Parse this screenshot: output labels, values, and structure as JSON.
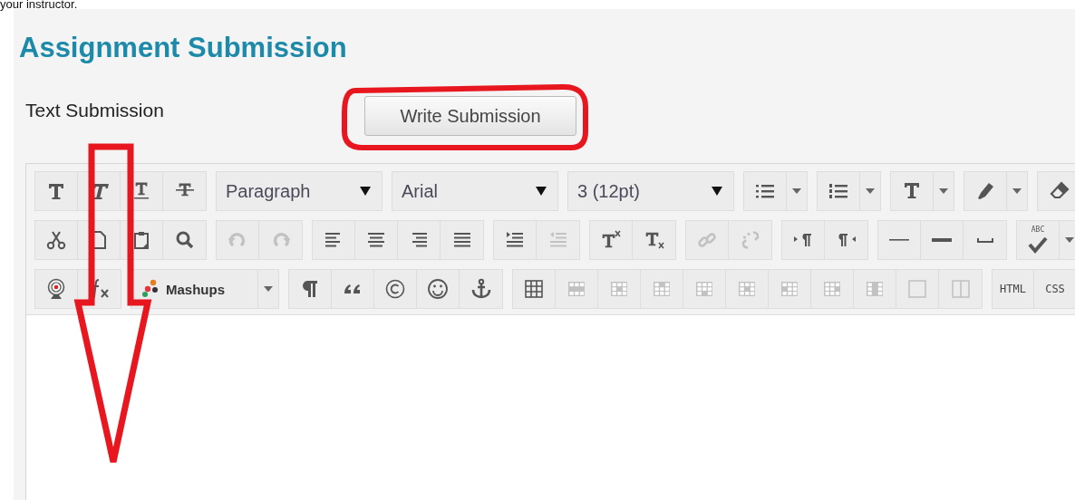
{
  "top_text": "your instructor.",
  "title": "Assignment Submission",
  "text_submission": {
    "label": "Text Submission",
    "button": "Write Submission"
  },
  "toolbar": {
    "rows": [
      {
        "groups": [
          {
            "items": [
              {
                "kind": "bold",
                "disabled": false
              },
              {
                "kind": "italic",
                "disabled": false
              },
              {
                "kind": "underline",
                "disabled": false
              },
              {
                "kind": "strike",
                "disabled": false
              }
            ]
          },
          {
            "items": [
              {
                "kind": "select",
                "value": "Paragraph",
                "disabled": false
              }
            ]
          },
          {
            "items": [
              {
                "kind": "select",
                "value": "Arial",
                "disabled": false
              }
            ]
          },
          {
            "items": [
              {
                "kind": "select",
                "value": "3 (12pt)",
                "disabled": false
              }
            ]
          },
          {
            "items": [
              {
                "kind": "bullets",
                "disabled": false
              }
            ]
          },
          {
            "items": [
              {
                "kind": "numbers",
                "disabled": false
              }
            ]
          },
          {
            "items": [
              {
                "kind": "textcolor",
                "disabled": false
              }
            ]
          },
          {
            "items": [
              {
                "kind": "marker",
                "disabled": false
              }
            ]
          },
          {
            "items": [
              {
                "kind": "eraser",
                "disabled": false
              }
            ]
          }
        ]
      },
      {
        "groups": [
          {
            "items": [
              {
                "kind": "cut",
                "disabled": false
              },
              {
                "kind": "copy",
                "disabled": false
              },
              {
                "kind": "paste",
                "disabled": false
              },
              {
                "kind": "find",
                "disabled": false
              }
            ]
          },
          {
            "items": [
              {
                "kind": "undo",
                "disabled": true
              },
              {
                "kind": "redo",
                "disabled": true
              }
            ]
          },
          {
            "items": [
              {
                "kind": "alignleft",
                "disabled": false
              },
              {
                "kind": "aligncenter",
                "disabled": false
              },
              {
                "kind": "alignright",
                "disabled": false
              },
              {
                "kind": "justify",
                "disabled": false
              }
            ]
          },
          {
            "items": [
              {
                "kind": "indent",
                "disabled": false
              },
              {
                "kind": "outdent",
                "disabled": true
              }
            ]
          },
          {
            "items": [
              {
                "kind": "sup",
                "disabled": false
              },
              {
                "kind": "sub",
                "disabled": false
              }
            ]
          },
          {
            "items": [
              {
                "kind": "link",
                "disabled": true
              },
              {
                "kind": "unlink",
                "disabled": true
              }
            ]
          },
          {
            "items": [
              {
                "kind": "ltr",
                "disabled": false
              },
              {
                "kind": "rtl",
                "disabled": false
              }
            ]
          },
          {
            "items": [
              {
                "kind": "hr",
                "disabled": false
              },
              {
                "kind": "thickhr",
                "disabled": false
              },
              {
                "kind": "nbsp",
                "disabled": false
              }
            ]
          },
          {
            "items": [
              {
                "kind": "spell",
                "label": "ABC",
                "disabled": false
              }
            ]
          }
        ]
      },
      {
        "groups": [
          {
            "items": [
              {
                "kind": "webcam",
                "disabled": false
              },
              {
                "kind": "formula",
                "disabled": false
              }
            ]
          },
          {
            "items": [
              {
                "kind": "mashups",
                "label": "Mashups",
                "disabled": false
              }
            ]
          },
          {
            "items": [
              {
                "kind": "pilcrow",
                "disabled": false
              },
              {
                "kind": "quote",
                "disabled": false
              },
              {
                "kind": "copyright",
                "disabled": false
              },
              {
                "kind": "smiley",
                "disabled": false
              },
              {
                "kind": "anchor",
                "disabled": false
              }
            ]
          },
          {
            "items": [
              {
                "kind": "table",
                "disabled": false
              },
              {
                "kind": "tablerow",
                "disabled": true
              },
              {
                "kind": "tablecell",
                "disabled": true
              },
              {
                "kind": "rowabove",
                "disabled": true
              },
              {
                "kind": "rowbelow",
                "disabled": true
              },
              {
                "kind": "deleterow",
                "disabled": true
              },
              {
                "kind": "colleft",
                "disabled": true
              },
              {
                "kind": "colright",
                "disabled": true
              },
              {
                "kind": "deletecol",
                "disabled": true
              },
              {
                "kind": "square",
                "disabled": true
              },
              {
                "kind": "columns",
                "disabled": true
              }
            ]
          },
          {
            "items": [
              {
                "kind": "text",
                "label": "HTML",
                "disabled": false
              },
              {
                "kind": "text",
                "label": "CSS",
                "disabled": false
              }
            ]
          }
        ]
      }
    ]
  }
}
